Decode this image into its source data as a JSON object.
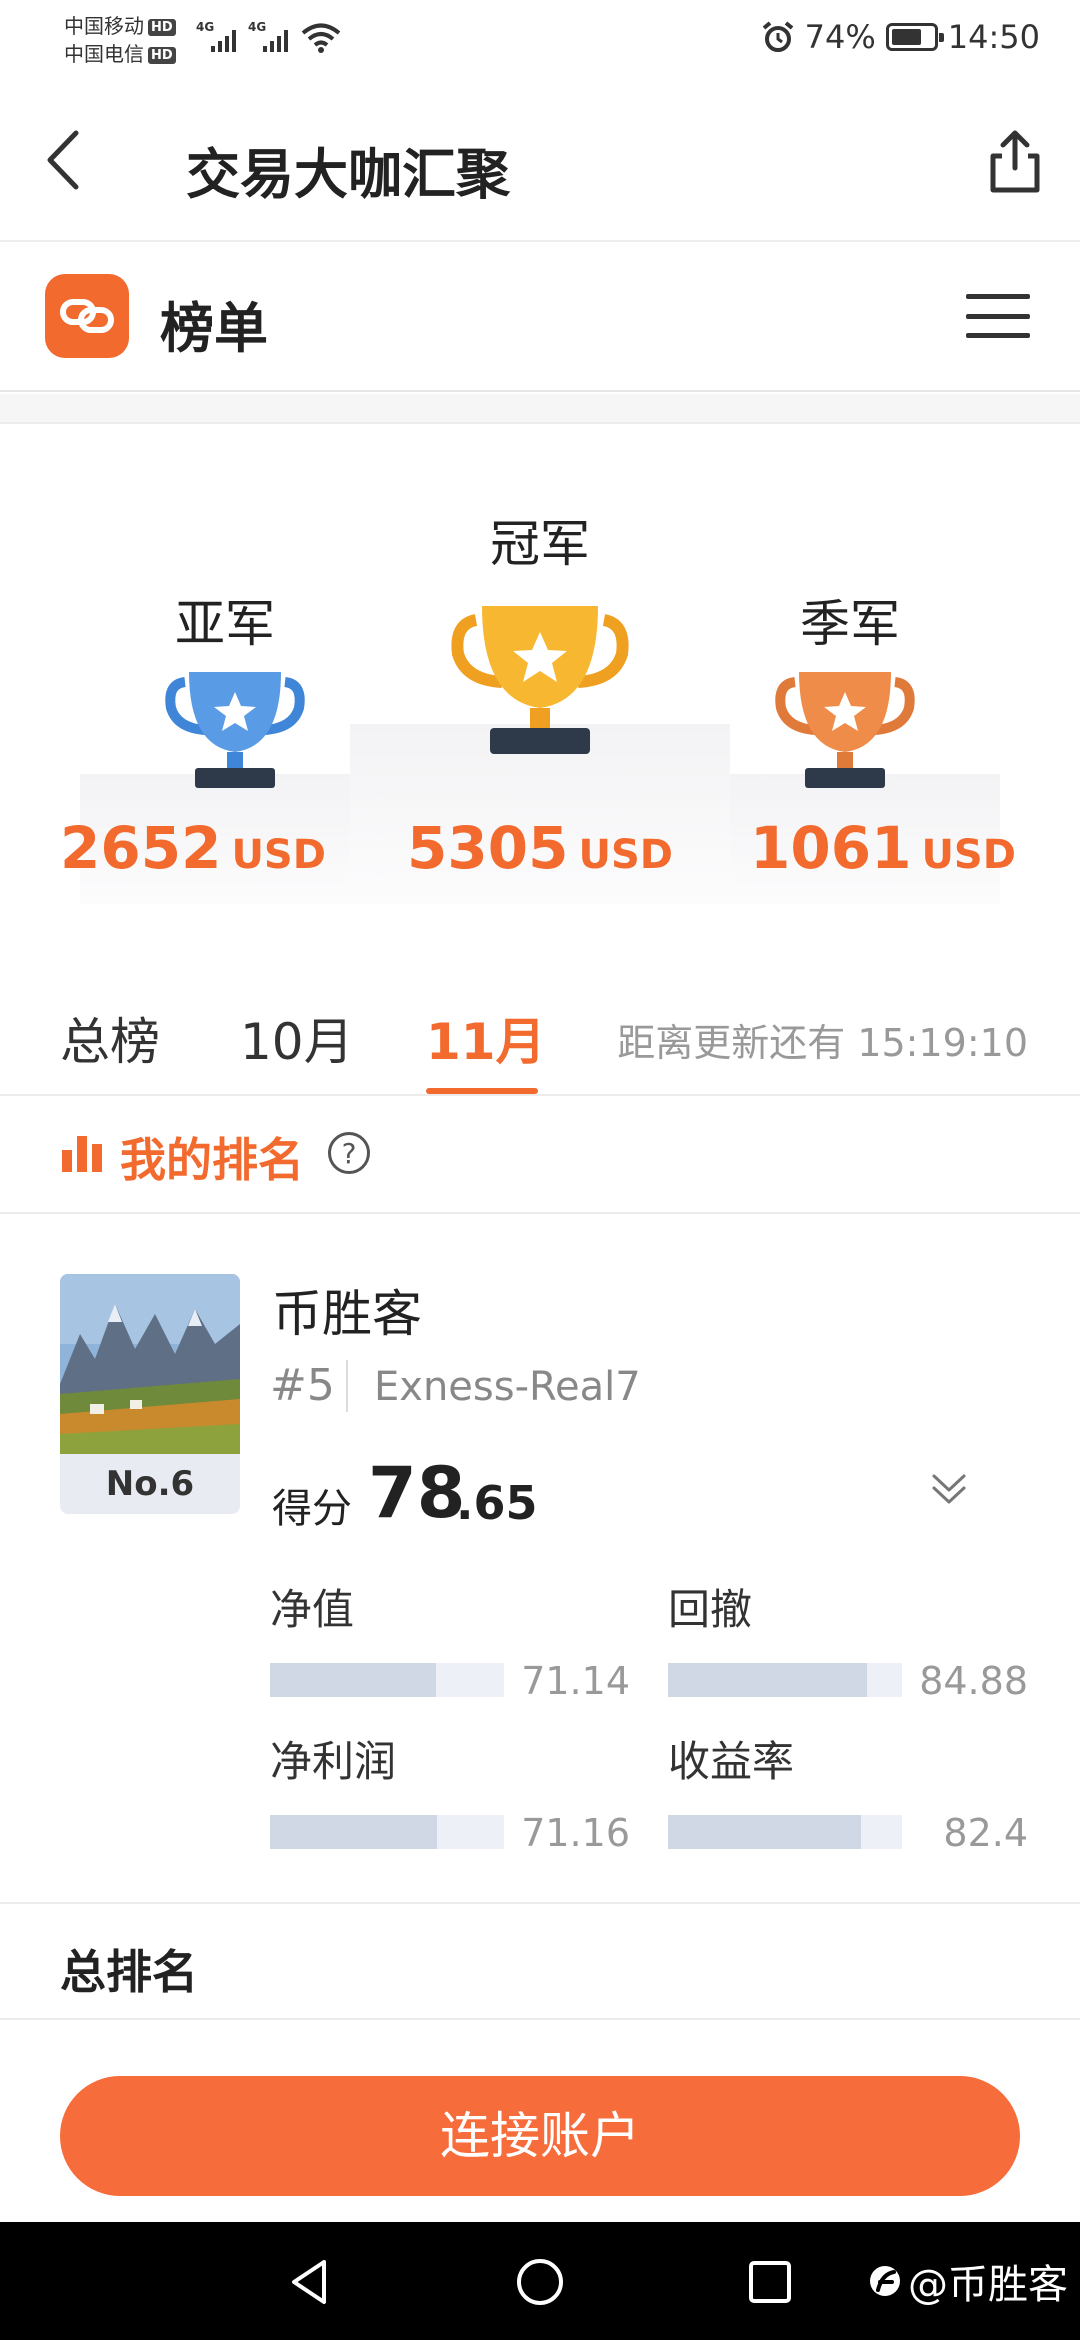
{
  "status_bar": {
    "carrier1": "中国移动",
    "carrier2": "中国电信",
    "hd": "HD",
    "net1": "4G",
    "net2": "4G",
    "battery": "74%",
    "battery_level": 0.74,
    "time": "14:50"
  },
  "header": {
    "title": "交易大咖汇聚"
  },
  "brand": {
    "title": "榜单",
    "accent_color": "#f26a2e"
  },
  "podium": {
    "first": {
      "label": "冠军",
      "amount": "5305",
      "unit": "USD"
    },
    "second": {
      "label": "亚军",
      "amount": "2652",
      "unit": "USD"
    },
    "third": {
      "label": "季军",
      "amount": "1061",
      "unit": "USD"
    }
  },
  "tabs": {
    "items": [
      {
        "label": "总榜"
      },
      {
        "label": "10月"
      },
      {
        "label": "11月"
      }
    ],
    "active_index": 2,
    "countdown": "距离更新还有 15:19:10"
  },
  "my_rank": {
    "title": "我的排名",
    "help": "?",
    "user_name": "币胜客",
    "rank_no": "No.6",
    "user_id": "#5",
    "account": "Exness-Real7",
    "score_label": "得分",
    "score_int": "78",
    "score_dec": ".65",
    "metrics": [
      {
        "label": "净值",
        "value": "71.14",
        "fill": 0.7114
      },
      {
        "label": "回撤",
        "value": "84.88",
        "fill": 0.8488
      },
      {
        "label": "净利润",
        "value": "71.16",
        "fill": 0.7116
      },
      {
        "label": "收益率",
        "value": "82.4",
        "fill": 0.824
      }
    ]
  },
  "total_rank": {
    "title": "总排名"
  },
  "cta": {
    "label": "连接账户"
  },
  "watermark": {
    "text": "@币胜客"
  }
}
